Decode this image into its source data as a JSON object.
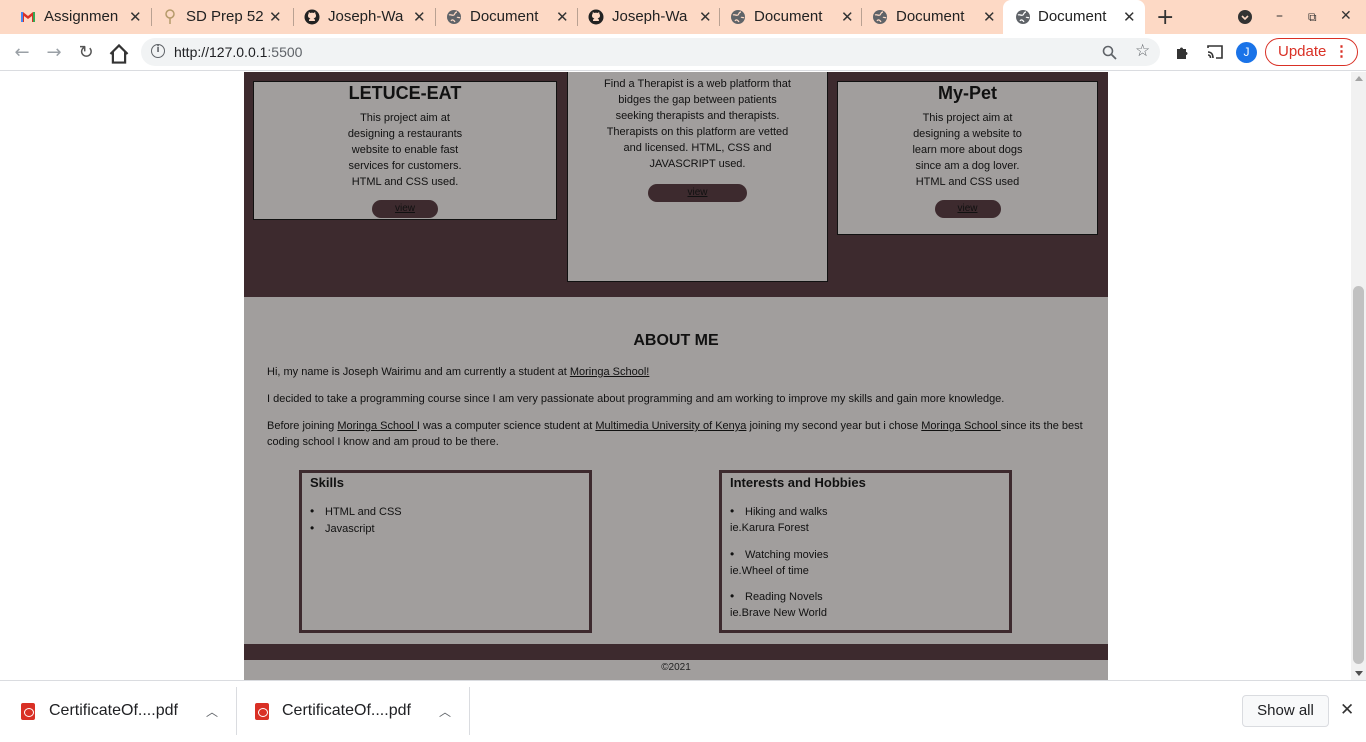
{
  "browser": {
    "tabs": [
      {
        "title": "Assignmen",
        "icon": "gmail-icon"
      },
      {
        "title": "SD Prep 52",
        "icon": "tree-icon"
      },
      {
        "title": "Joseph-Wa",
        "icon": "github-icon"
      },
      {
        "title": "Document",
        "icon": "globe-icon"
      },
      {
        "title": "Joseph-Wa",
        "icon": "github-icon"
      },
      {
        "title": "Document",
        "icon": "globe-icon"
      },
      {
        "title": "Document",
        "icon": "globe-icon"
      },
      {
        "title": "Document",
        "icon": "globe-icon",
        "active": true
      }
    ],
    "url_host": "http://127.0.0.1",
    "url_port": ":5500",
    "profile_initial": "J",
    "update_label": "Update",
    "accent_color": "#d93025"
  },
  "projects": [
    {
      "title": "LETUCE-EAT",
      "description": "This project aim at designing a restaurants website to enable fast services for customers. HTML and CSS used.",
      "button": "view"
    },
    {
      "title": "",
      "description": "Find a Therapist is a web platform that bidges the gap between patients seeking therapists and therapists. Therapists on this platform are vetted and licensed. HTML, CSS and JAVASCRIPT used.",
      "button": "view"
    },
    {
      "title": "My-Pet",
      "description": "This project aim at designing a website to learn more about dogs since am a dog lover. HTML and CSS used",
      "button": "view"
    }
  ],
  "about": {
    "heading": "ABOUT ME",
    "p1_text": "Hi, my name is Joseph Wairimu and am currently a student at ",
    "p1_link": "Moringa School!",
    "p2_text": "I decided to take a programming course since I am very passionate about programming and am working to improve my skills and gain more knowledge.",
    "p3_a": "Before joining ",
    "p3_link1": "Moringa School ",
    "p3_b": "I was a computer science student at ",
    "p3_link2": "Multimedia University of Kenya",
    "p3_c": " joining my second year but i chose ",
    "p3_link3": "Moringa School ",
    "p3_d": "since its the best coding school I know and am proud to be there."
  },
  "skills": {
    "heading": "Skills",
    "items": [
      "HTML and CSS",
      "Javascript"
    ]
  },
  "hobbies": {
    "heading": "Interests and Hobbies",
    "items": [
      {
        "name": "Hiking and walks",
        "example": "ie.Karura Forest"
      },
      {
        "name": "Watching movies",
        "example": "ie.Wheel of time"
      },
      {
        "name": "Reading Novels",
        "example": "ie.Brave New World"
      }
    ]
  },
  "footer": {
    "copyright": "©2021"
  },
  "theme": {
    "dark": "#3d2a2e",
    "grey": "#a19e9d"
  },
  "downloads": {
    "items": [
      {
        "name": "CertificateOf....pdf"
      },
      {
        "name": "CertificateOf....pdf"
      }
    ],
    "show_all": "Show all"
  }
}
